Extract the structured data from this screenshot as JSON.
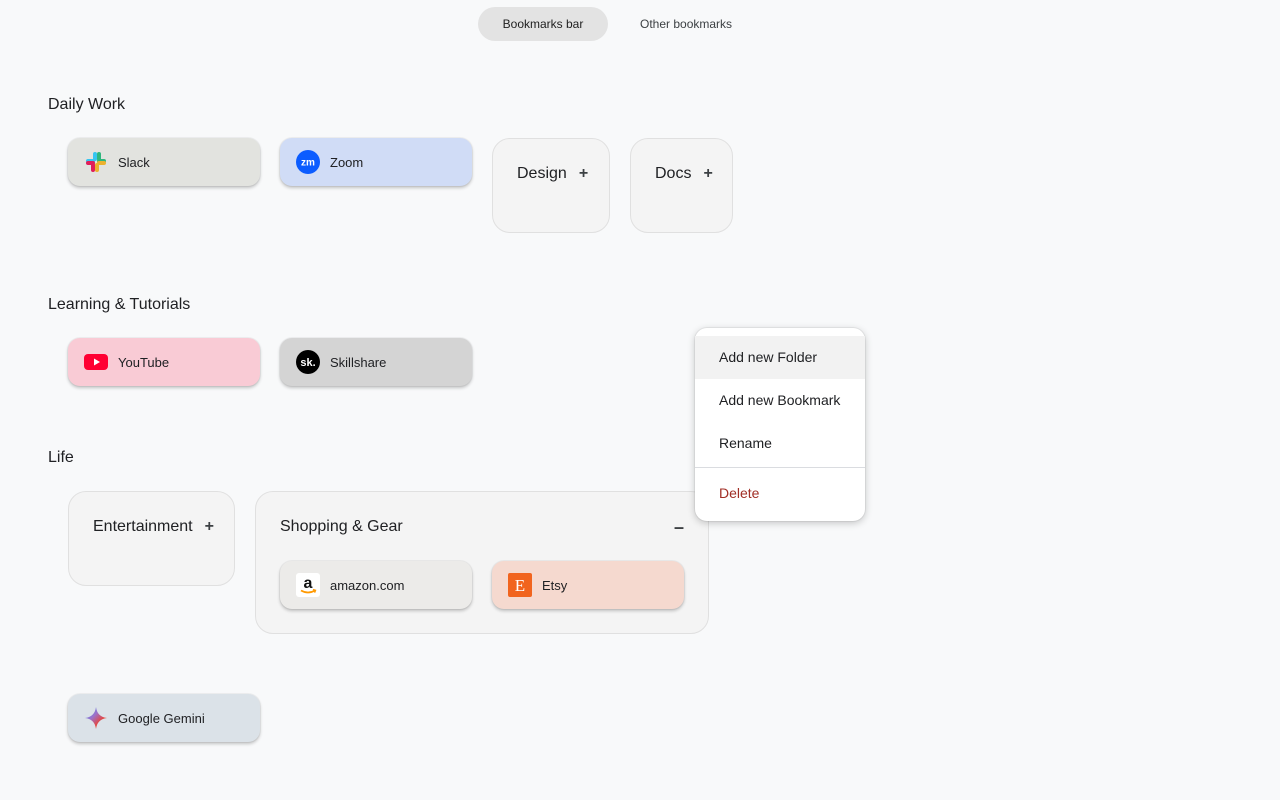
{
  "tabs": {
    "bookmarks_bar": "Bookmarks bar",
    "other_bookmarks": "Other bookmarks"
  },
  "sections": {
    "daily_work": {
      "title": "Daily Work",
      "bookmarks": [
        {
          "label": "Slack",
          "icon": "slack-icon",
          "bg": "#e2e3df"
        },
        {
          "label": "Zoom",
          "icon": "zoom-icon",
          "bg": "#d0dcf6"
        }
      ],
      "folders": [
        {
          "label": "Design"
        },
        {
          "label": "Docs"
        }
      ]
    },
    "learning": {
      "title": "Learning & Tutorials",
      "bookmarks": [
        {
          "label": "YouTube",
          "icon": "youtube-icon",
          "bg": "#f9cbd5"
        },
        {
          "label": "Skillshare",
          "icon": "skillshare-icon",
          "bg": "#d4d4d4"
        }
      ]
    },
    "life": {
      "title": "Life",
      "folders": [
        {
          "label": "Entertainment"
        },
        {
          "label": "Shopping & Gear",
          "bookmarks": [
            {
              "label": "amazon.com",
              "icon": "amazon-icon",
              "bg": "#ecebe9"
            },
            {
              "label": "Etsy",
              "icon": "etsy-icon",
              "bg": "#f5d9cf"
            }
          ]
        }
      ]
    },
    "loose": {
      "bookmarks": [
        {
          "label": "Google Gemini",
          "icon": "gemini-icon",
          "bg": "#dbe2e8"
        }
      ]
    }
  },
  "context_menu": {
    "items": [
      {
        "label": "Add new Folder"
      },
      {
        "label": "Add new Bookmark"
      },
      {
        "label": "Rename"
      },
      {
        "label": "Delete"
      }
    ]
  },
  "colors": {
    "delete": "#a12e25",
    "active_tab_bg": "#e3e3e3"
  }
}
